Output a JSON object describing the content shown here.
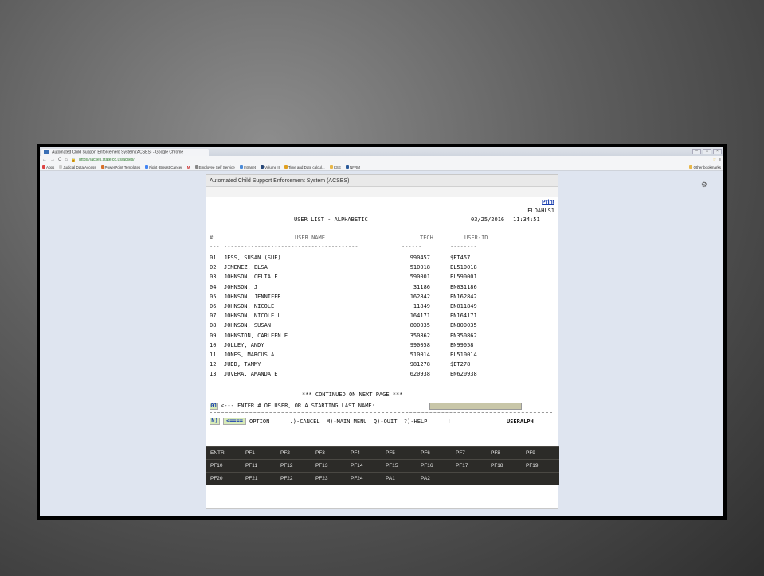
{
  "browser": {
    "tab_title": "Automated Child Support Enforcement System (ACSES) - Google Chrome",
    "url": "https://acses.state.co.us/acses/",
    "bookmarks": [
      "Apps",
      "Judicial Data Access",
      "PowerPoint Templates",
      "Fight -Breast Cancer",
      "M",
      "Employee Self Service",
      "Intranet",
      "Volume II",
      "Time and Date calcul...",
      "CSE",
      "NFRM"
    ],
    "other_bookmarks": "Other bookmarks"
  },
  "acses": {
    "title": "Automated Child Support Enforcement System (ACSES)",
    "print": "Print",
    "screen_id": "ELDAHLS1",
    "heading": "USER LIST - ALPHABETIC",
    "date": "03/25/2016",
    "time": "11:34:51",
    "columns": {
      "num": "#",
      "name": "USER NAME",
      "tech": "TECH",
      "uid": "USER-ID",
      "num_dash": "---",
      "name_dash": "----------------------------------------",
      "tech_dash": "------",
      "uid_dash": "--------"
    },
    "rows": [
      {
        "num": "01",
        "name": "JESS, SUSAN (SUE)",
        "tech": "990457",
        "uid": "$ET457"
      },
      {
        "num": "02",
        "name": "JIMENEZ, ELSA",
        "tech": "510018",
        "uid": "EL510018"
      },
      {
        "num": "03",
        "name": "JOHNSON, CELIA F",
        "tech": "590001",
        "uid": "EL590001"
      },
      {
        "num": "04",
        "name": "JOHNSON, J",
        "tech": "31186",
        "uid": "EN031186"
      },
      {
        "num": "05",
        "name": "JOHNSON, JENNIFER",
        "tech": "162842",
        "uid": "EN162842"
      },
      {
        "num": "06",
        "name": "JOHNSON, NICOLE",
        "tech": "11849",
        "uid": "EN011849"
      },
      {
        "num": "07",
        "name": "JOHNSON, NICOLE L",
        "tech": "164171",
        "uid": "EN164171"
      },
      {
        "num": "08",
        "name": "JOHNSON, SUSAN",
        "tech": "800035",
        "uid": "EN800035"
      },
      {
        "num": "09",
        "name": "JOHNSTON, CARLEEN E",
        "tech": "350862",
        "uid": "EN350862"
      },
      {
        "num": "10",
        "name": "JOLLEY, ANDY",
        "tech": "990058",
        "uid": "EN99058"
      },
      {
        "num": "11",
        "name": "JONES, MARCUS A",
        "tech": "510014",
        "uid": "EL510014"
      },
      {
        "num": "12",
        "name": "JUDD, TAMMY",
        "tech": "981278",
        "uid": "$ET278"
      },
      {
        "num": "13",
        "name": "JUVERA, AMANDA E",
        "tech": "620938",
        "uid": "EN620938"
      }
    ],
    "continued": "*** CONTINUED ON NEXT PAGE ***",
    "entry_value": "01",
    "entry_prompt": "<--- ENTER # OF USER, OR A STARTING LAST NAME:",
    "option_value": "N)",
    "option_arrow": "<====",
    "option_text": "OPTION      .)-CANCEL  M)-MAIN MENU  Q)-QUIT  ?)-HELP      !",
    "program": "USERALPH",
    "pfkeys": [
      [
        "ENTR",
        "PF1",
        "PF2",
        "PF3",
        "PF4",
        "PF5",
        "PF6",
        "PF7",
        "PF8",
        "PF9"
      ],
      [
        "PF10",
        "PF11",
        "PF12",
        "PF13",
        "PF14",
        "PF15",
        "PF16",
        "PF17",
        "PF18",
        "PF19"
      ],
      [
        "PF20",
        "PF21",
        "PF22",
        "PF23",
        "PF24",
        "PA1",
        "PA2"
      ]
    ]
  }
}
